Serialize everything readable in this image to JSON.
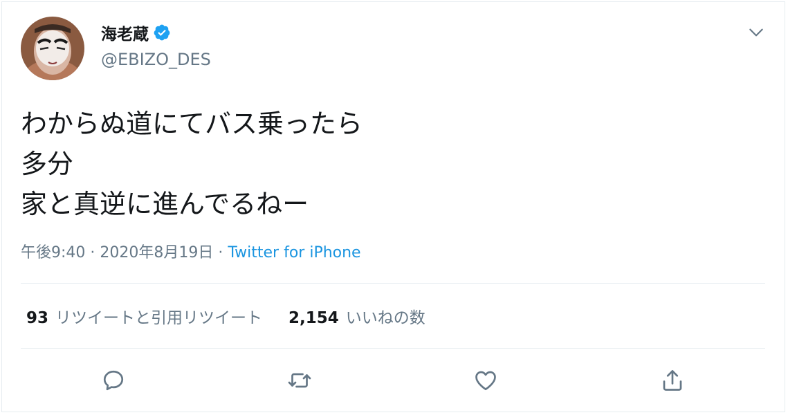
{
  "user": {
    "display_name": "海老蔵",
    "handle": "@EBIZO_DES",
    "verified": true
  },
  "tweet": {
    "lines": [
      "わからぬ道にてバス乗ったら",
      "多分",
      "家と真逆に進んでるねー"
    ],
    "time": "午後9:40",
    "separator1": " · ",
    "date": "2020年8月19日",
    "separator2": " · ",
    "source": "Twitter for iPhone"
  },
  "stats": {
    "retweets_count": "93",
    "retweets_label": "リツイートと引用リツイート",
    "likes_count": "2,154",
    "likes_label": "いいねの数"
  },
  "icons": {
    "menu": "chevron-down-icon",
    "reply": "reply-icon",
    "retweet": "retweet-icon",
    "like": "heart-icon",
    "share": "share-icon",
    "verified": "verified-badge-icon"
  },
  "colors": {
    "text": "#14171a",
    "secondary": "#657786",
    "link": "#1b95e0",
    "verified": "#1da1f2",
    "divider": "#e6ecf0"
  }
}
